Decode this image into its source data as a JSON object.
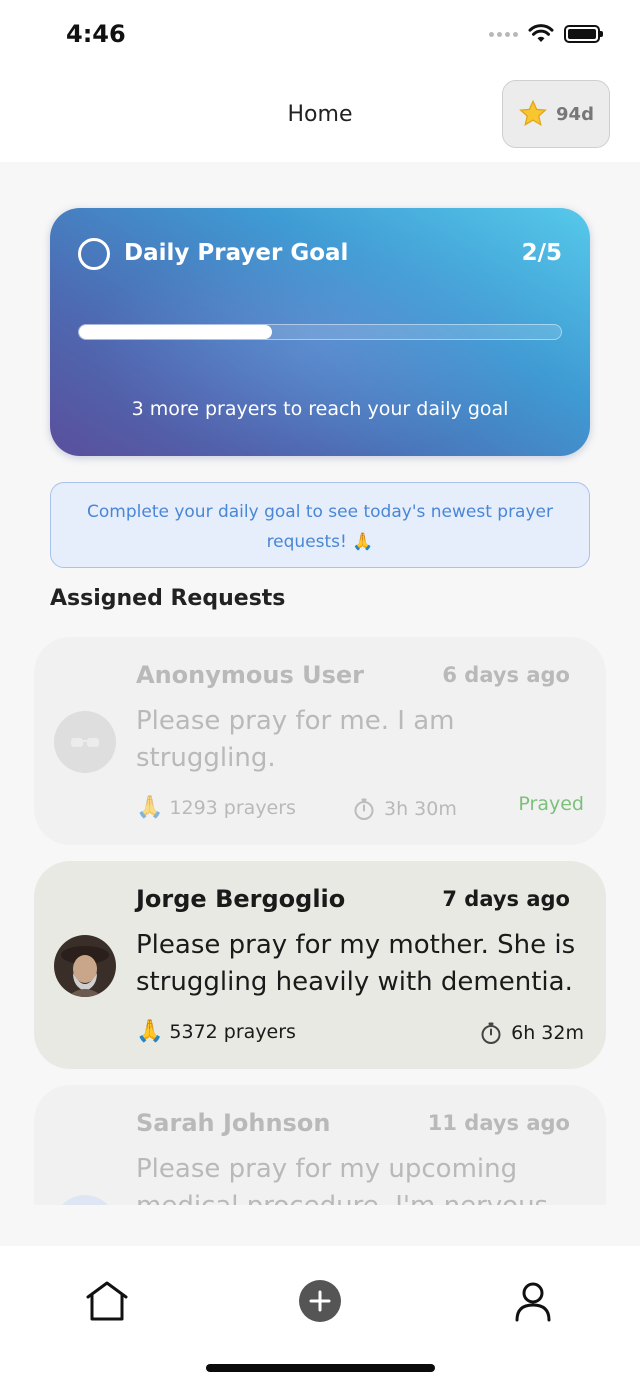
{
  "status_bar": {
    "time": "4:46"
  },
  "header": {
    "title": "Home",
    "streak": {
      "icon": "star-icon",
      "label": "94d"
    }
  },
  "goal_card": {
    "title": "Daily Prayer Goal",
    "count": "2/5",
    "progress": 0.4,
    "caption": "3 more prayers to reach your daily goal"
  },
  "info_banner": {
    "text": "Complete your daily goal to see today's newest prayer requests! 🙏"
  },
  "assigned": {
    "title": "Assigned Requests",
    "requests": [
      {
        "name": "Anonymous User",
        "age": "6 days ago",
        "message": "Please pray for me. I am struggling.",
        "prayers": "1293 prayers",
        "timer": "3h 30m",
        "status": "Prayed",
        "avatar": "sunglasses-avatar-icon"
      },
      {
        "name": "Jorge Bergoglio",
        "age": "7 days ago",
        "message": "Please pray for my mother. She is struggling heavily with dementia.",
        "prayers": "5372 prayers",
        "timer": "6h 32m",
        "avatar": "user-photo"
      },
      {
        "name": "Sarah Johnson",
        "age": "11 days ago",
        "message": "Please pray for my upcoming medical procedure. I'm nervous",
        "avatar": "user-avatar"
      }
    ]
  },
  "tabbar": {
    "items": [
      {
        "icon": "home-icon"
      },
      {
        "icon": "add-icon"
      },
      {
        "icon": "profile-icon"
      }
    ]
  },
  "colors": {
    "accent_blue": "#4a86d6",
    "prayed_green": "#7cc07c",
    "banner_bg": "#e6eefb"
  }
}
